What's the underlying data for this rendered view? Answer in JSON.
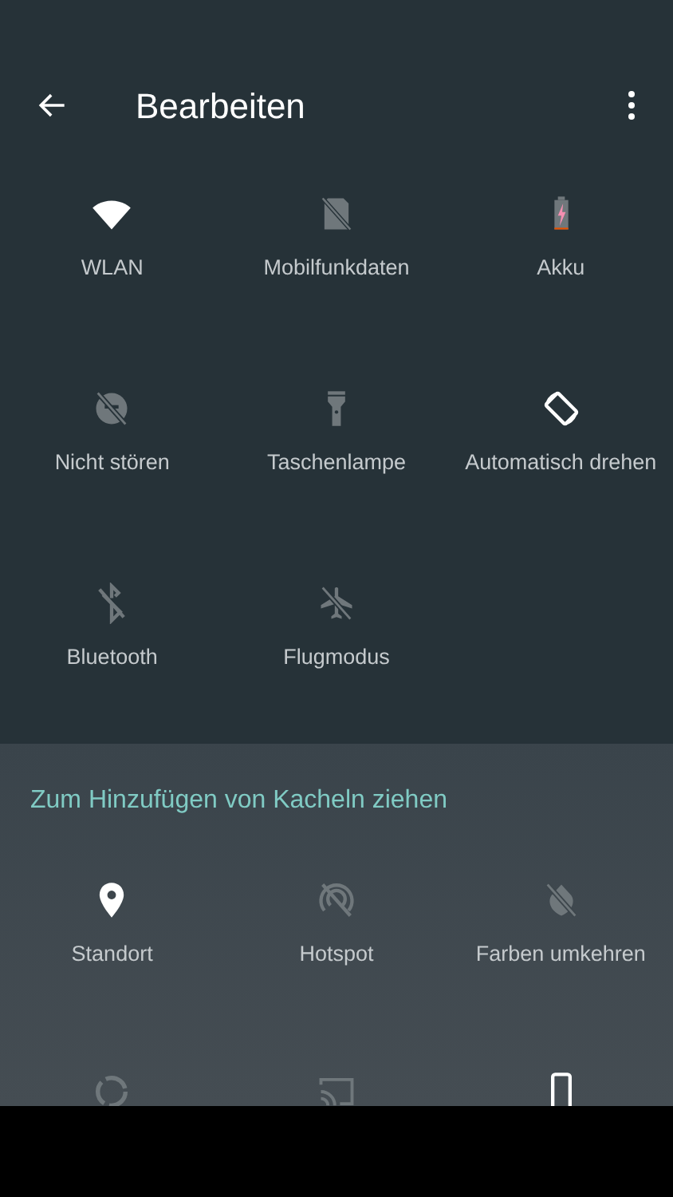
{
  "header": {
    "title": "Bearbeiten"
  },
  "active_tiles": [
    {
      "kind": "wifi",
      "label": "WLAN",
      "active": true
    },
    {
      "kind": "mobile-data",
      "label": "Mobilfunkdaten",
      "active": false
    },
    {
      "kind": "battery",
      "label": "Akku",
      "active": false
    },
    {
      "kind": "do-not-disturb",
      "label": "Nicht stören",
      "active": false
    },
    {
      "kind": "flashlight",
      "label": "Taschenlampe",
      "active": false
    },
    {
      "kind": "rotate",
      "label": "Automatisch drehen",
      "active": true
    },
    {
      "kind": "bluetooth",
      "label": "Bluetooth",
      "active": false
    },
    {
      "kind": "airplane",
      "label": "Flugmodus",
      "active": false
    }
  ],
  "available_section": {
    "title": "Zum Hinzufügen von Kacheln ziehen",
    "tiles": [
      {
        "kind": "location",
        "label": "Standort",
        "active": true
      },
      {
        "kind": "hotspot",
        "label": "Hotspot",
        "active": false
      },
      {
        "kind": "invert-colors",
        "label": "Farben umkehren",
        "active": false
      },
      {
        "kind": "data-saver",
        "active": false
      },
      {
        "kind": "cast",
        "active": false
      },
      {
        "kind": "phone",
        "active": true
      }
    ]
  }
}
